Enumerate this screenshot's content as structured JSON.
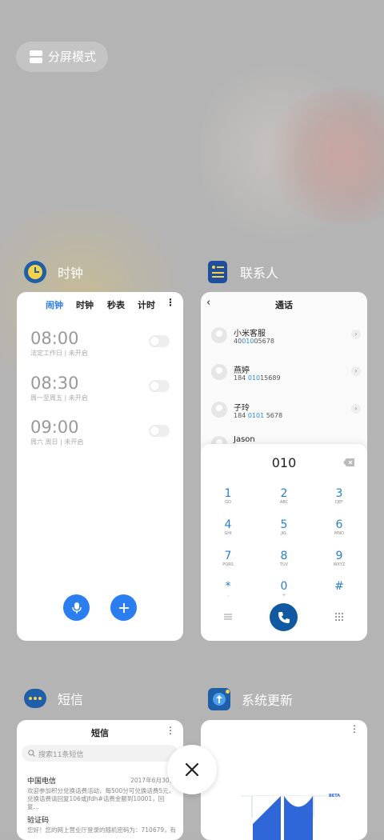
{
  "split_mode": {
    "label": "分屏模式"
  },
  "apps": {
    "clock": {
      "title": "时钟",
      "tabs": [
        "闹钟",
        "时钟",
        "秒表",
        "计时"
      ],
      "alarms": [
        {
          "time": "08:00",
          "sub": "法定工作日 | 未开启"
        },
        {
          "time": "08:30",
          "sub": "周一至周五 | 未开启"
        },
        {
          "time": "09:00",
          "sub": "周六 周日 | 未开启"
        }
      ]
    },
    "contacts": {
      "title": "联系人",
      "header": "通话",
      "list": [
        {
          "name": "小米客服",
          "num_pre": "40",
          "num_hl": "010",
          "num_post": "05678"
        },
        {
          "name": "燕婷",
          "num_pre": "184 ",
          "num_hl": "010",
          "num_post": "15689"
        },
        {
          "name": "子玲",
          "num_pre": "184 ",
          "num_hl": "0101",
          "num_post": " 5678"
        },
        {
          "name": "Jason",
          "num_pre": "",
          "num_hl": "",
          "num_post": ""
        }
      ],
      "dial_input": "010",
      "keys": [
        {
          "d": "1",
          "l": "GO"
        },
        {
          "d": "2",
          "l": "ABC"
        },
        {
          "d": "3",
          "l": "DEF"
        },
        {
          "d": "4",
          "l": "GHI"
        },
        {
          "d": "5",
          "l": "JKL"
        },
        {
          "d": "6",
          "l": "MNO"
        },
        {
          "d": "7",
          "l": "PQRS"
        },
        {
          "d": "8",
          "l": "TUV"
        },
        {
          "d": "9",
          "l": "WXYZ"
        },
        {
          "d": "*",
          "l": ","
        },
        {
          "d": "0",
          "l": "+"
        },
        {
          "d": "#",
          "l": ""
        }
      ]
    },
    "sms": {
      "title": "短信",
      "header": "短信",
      "search_placeholder": "搜索11条短信",
      "messages": [
        {
          "sender": "中国电信",
          "date": "2017年6月30日",
          "preview": "欢迎参加积分兑换话费活动，每500分可兑换话费5元，兑换话费请回复106或jfdh#话费金额到10001，回复..."
        },
        {
          "sender": "验证码",
          "preview": "您好！您的网上营业厅登录的随机密码为：710679，有"
        }
      ]
    },
    "updater": {
      "title": "系统更新",
      "badge": "BETA"
    }
  },
  "colors": {
    "accent": "#2b7ef0",
    "call": "#1159a0",
    "highlight": "#2a8bd8"
  }
}
